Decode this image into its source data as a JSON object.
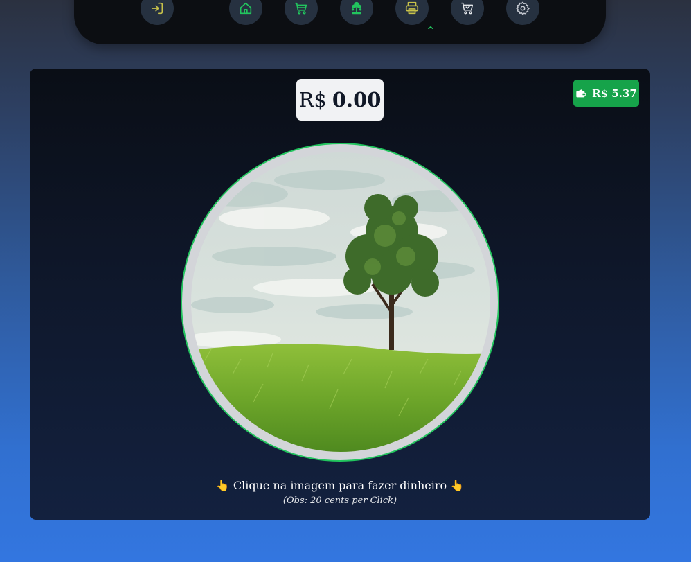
{
  "nav": {
    "items": [
      {
        "name": "logout",
        "icon": "logout-icon"
      },
      {
        "name": "home",
        "icon": "home-icon"
      },
      {
        "name": "cart",
        "icon": "cart-icon"
      },
      {
        "name": "money-tree",
        "icon": "money-tree-icon",
        "active": true
      },
      {
        "name": "printer",
        "icon": "printer-icon"
      },
      {
        "name": "shopping-cart-check",
        "icon": "cart-check-icon"
      },
      {
        "name": "settings",
        "icon": "gear-icon"
      }
    ],
    "active_caret": "^"
  },
  "balance": {
    "currency": "R$",
    "value": "0.00"
  },
  "wallet": {
    "icon": "wallet-icon",
    "label": "R$ 5.37"
  },
  "main": {
    "image": "tree-on-grass-hill",
    "hint_text": "Clique na imagem para fazer dinheiro",
    "hint_hand": "👆",
    "obs_text": "(Obs: 20 cents per Click)"
  },
  "colors": {
    "accent_green": "#22c55e",
    "wallet_green": "#16a34a",
    "topbar_bg": "#0c0e12",
    "icon_yellow": "#c8c24a"
  }
}
